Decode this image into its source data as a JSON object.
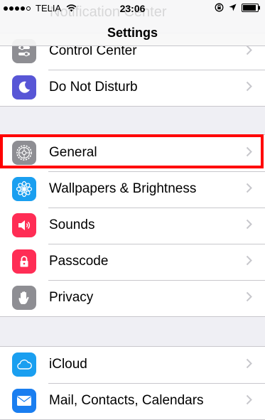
{
  "statusbar": {
    "carrier": "TELIA",
    "time": "23:06",
    "signal_bars_filled": 4,
    "signal_bars_total": 5,
    "icons": [
      "wifi-icon",
      "rotation-lock-icon",
      "location-arrow-icon",
      "battery-icon"
    ]
  },
  "navbar": {
    "title": "Settings",
    "scrolled_under_text": "Notification Center"
  },
  "groups": [
    {
      "rows": [
        {
          "label": "Control Center",
          "icon": "control-center-icon",
          "color": "#8e8e93"
        },
        {
          "label": "Do Not Disturb",
          "icon": "moon-icon",
          "color": "#5856d6"
        }
      ]
    },
    {
      "rows": [
        {
          "label": "General",
          "icon": "gear-icon",
          "color": "#8e8e93",
          "highlighted": true
        },
        {
          "label": "Wallpapers & Brightness",
          "icon": "flower-icon",
          "color": "#1a9ff0"
        },
        {
          "label": "Sounds",
          "icon": "speaker-icon",
          "color": "#ff2d55"
        },
        {
          "label": "Passcode",
          "icon": "lock-icon",
          "color": "#ff2d55"
        },
        {
          "label": "Privacy",
          "icon": "hand-icon",
          "color": "#8e8e93"
        }
      ]
    },
    {
      "rows": [
        {
          "label": "iCloud",
          "icon": "cloud-icon",
          "color": "#1a9ff0"
        },
        {
          "label": "Mail, Contacts, Calendars",
          "icon": "mail-icon",
          "color": "#1a7ef0"
        }
      ]
    }
  ],
  "colors": {
    "highlight": "#ff0000",
    "chevron": "#c7c7cc",
    "background": "#efeff4"
  }
}
